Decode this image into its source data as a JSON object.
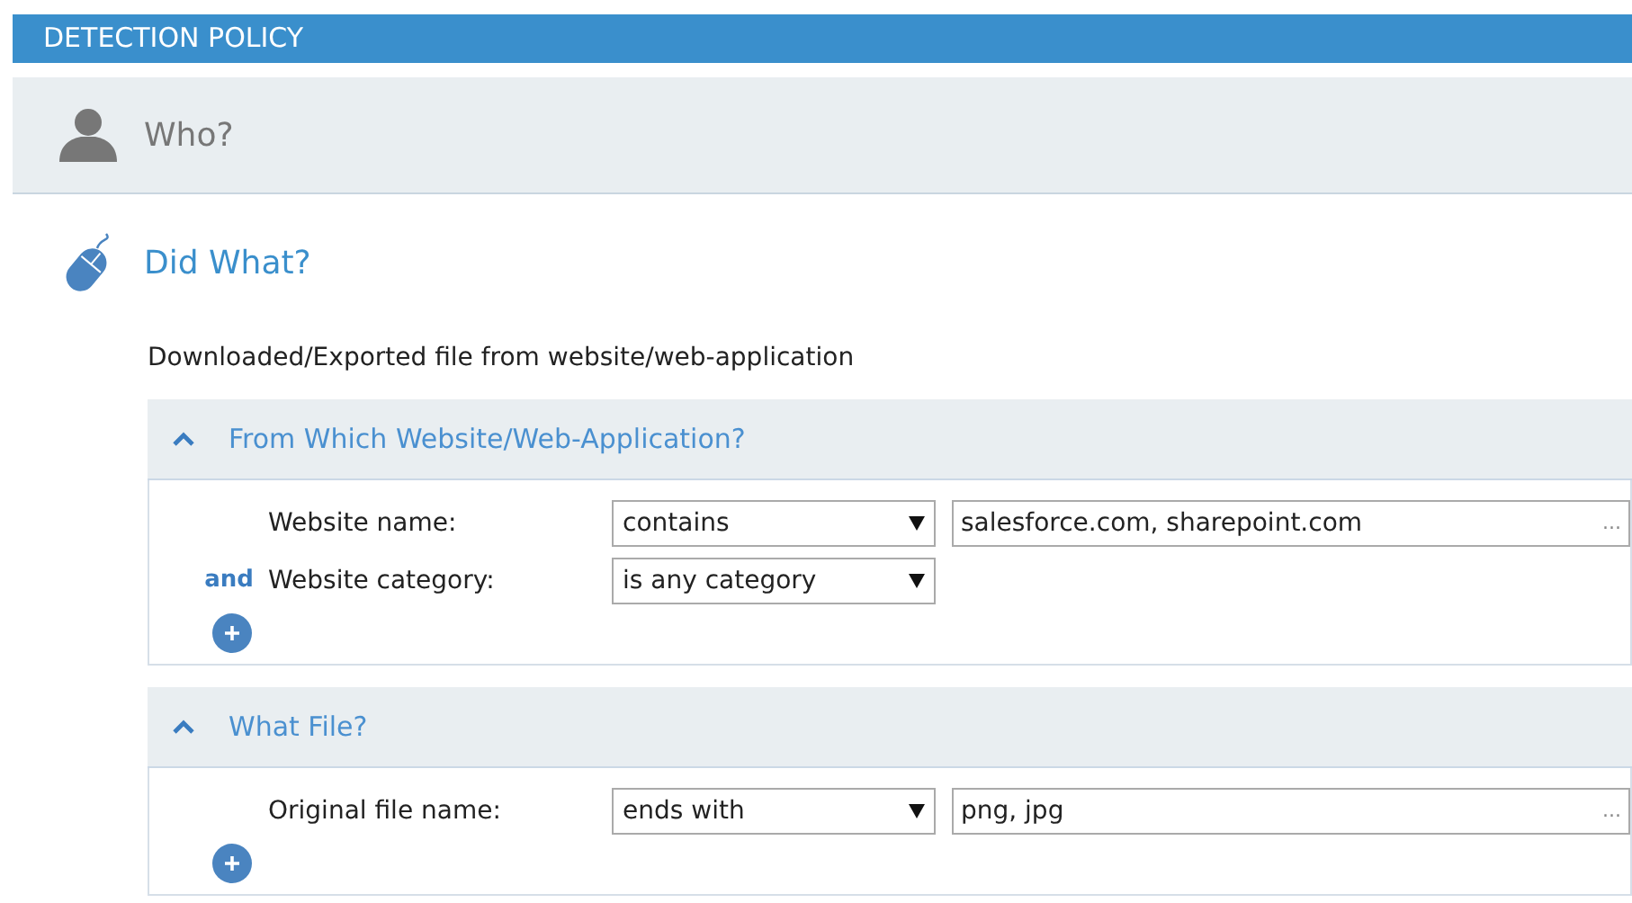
{
  "header": {
    "title": "DETECTION POLICY"
  },
  "who": {
    "title": "Who?"
  },
  "did_what": {
    "title": "Did What?",
    "description": "Downloaded/Exported file from website/web-application",
    "sections": [
      {
        "title": "From Which Website/Web-Application?",
        "expanded": true,
        "conditions": [
          {
            "label": "Website name:",
            "operator": "contains",
            "value": "salesforce.com, sharepoint.com",
            "more": "..."
          },
          {
            "connector": "and",
            "label": "Website category:",
            "operator": "is any category"
          }
        ]
      },
      {
        "title": "What File?",
        "expanded": true,
        "conditions": [
          {
            "label": "Original file name:",
            "operator": "ends with",
            "value": "png, jpg",
            "more": "..."
          }
        ]
      }
    ]
  }
}
